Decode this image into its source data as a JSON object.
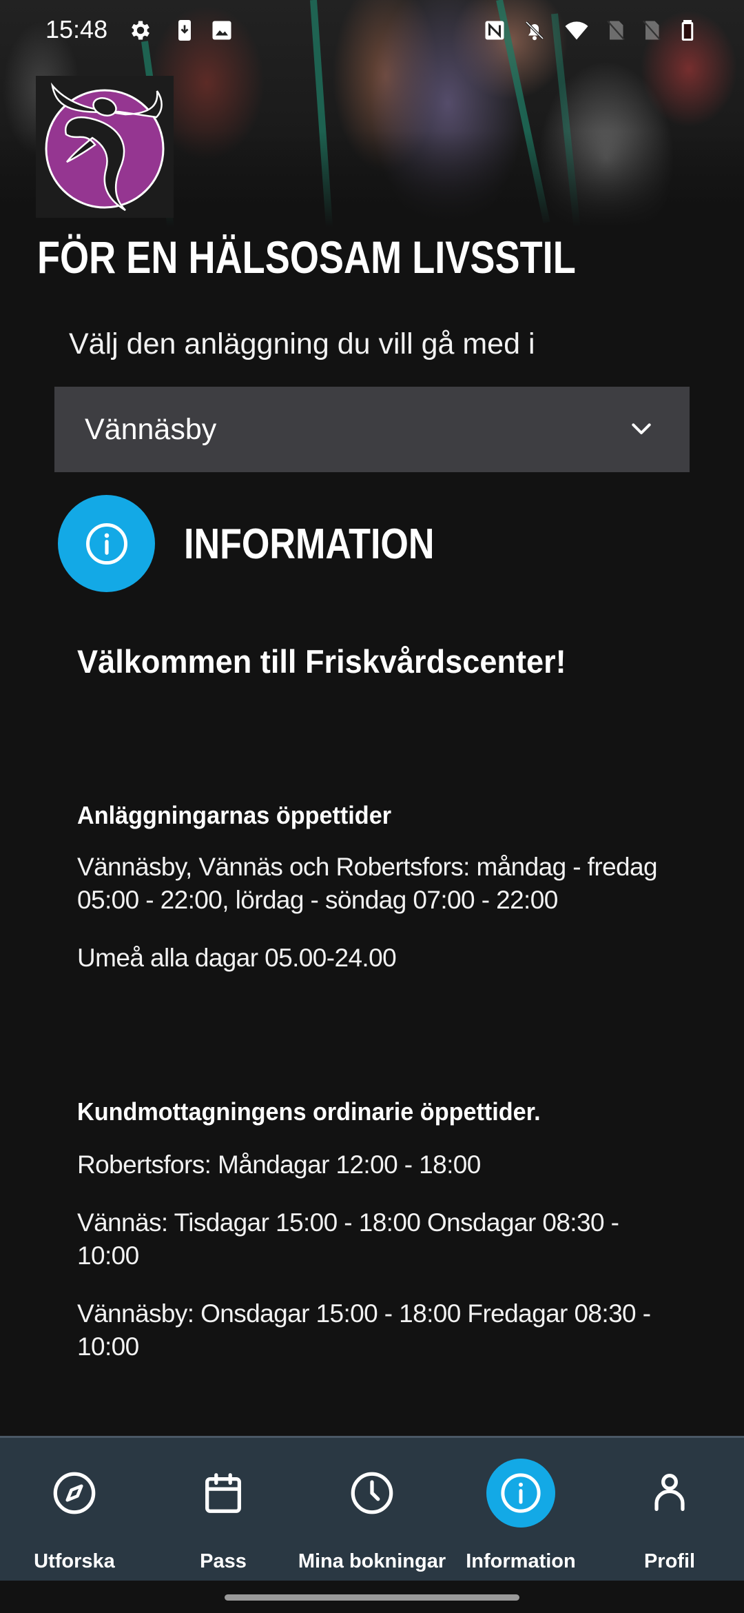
{
  "status_bar": {
    "time": "15:48",
    "left_icons": [
      "settings-icon",
      "download-icon",
      "image-icon"
    ],
    "right_icons": [
      "nfc-icon",
      "bell-off-icon",
      "wifi-icon",
      "no-sim-icon",
      "no-sim-icon",
      "battery-icon"
    ]
  },
  "hero": {
    "logo": "friskvardscenter-logo",
    "title": "FÖR EN HÄLSOSAM LIVSSTIL"
  },
  "facility_select": {
    "label": "Välj den anläggning du vill gå med i",
    "selected": "Vännäsby"
  },
  "info_header": {
    "title": "INFORMATION",
    "icon": "info-icon",
    "accent_color": "#13a9e6"
  },
  "content": {
    "welcome": "Välkommen till Friskvårdscenter!",
    "sections": [
      {
        "heading": "Anläggningarnas öppettider",
        "paragraphs": [
          "Vännäsby, Vännäs och Robertsfors: måndag - fredag 05:00 - 22:00, lördag - söndag 07:00 - 22:00",
          "Umeå alla dagar 05.00-24.00"
        ]
      },
      {
        "heading": "Kundmottagningens ordinarie öppettider.",
        "paragraphs": [
          "Robertsfors: Måndagar 12:00 - 18:00",
          "Vännäs: Tisdagar 15:00 - 18:00 Onsdagar 08:30 - 10:00",
          "Vännäsby: Onsdagar 15:00 - 18:00 Fredagar 08:30 - 10:00"
        ]
      }
    ]
  },
  "bottom_nav": {
    "items": [
      {
        "label": "Utforska",
        "icon": "compass-icon",
        "active": false
      },
      {
        "label": "Pass",
        "icon": "calendar-icon",
        "active": false
      },
      {
        "label": "Mina bokningar",
        "icon": "clock-icon",
        "active": false
      },
      {
        "label": "Information",
        "icon": "info-icon",
        "active": true
      },
      {
        "label": "Profil",
        "icon": "profile-icon",
        "active": false
      }
    ],
    "background": "#2a3843",
    "active_color": "#13a9e6"
  }
}
